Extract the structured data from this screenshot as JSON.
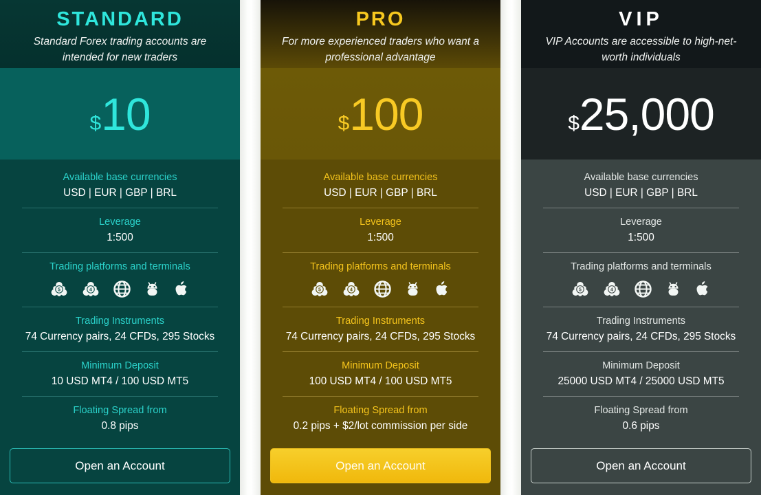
{
  "cards": [
    {
      "plan": "STANDARD",
      "description": "Standard Forex trading accounts are intended for new traders",
      "currency_symbol": "$",
      "price": "10",
      "features": [
        {
          "label": "Available base currencies",
          "value": "USD | EUR | GBP | BRL"
        },
        {
          "label": "Leverage",
          "value": "1:500"
        },
        {
          "label": "Trading platforms and terminals",
          "value": ""
        },
        {
          "label": "Trading Instruments",
          "value": "74 Currency pairs, 24 CFDs, 295 Stocks"
        },
        {
          "label": "Minimum Deposit",
          "value": "10 USD MT4 / 100 USD MT5"
        },
        {
          "label": "Floating Spread from",
          "value": "0.8 pips"
        }
      ],
      "platform_icons": [
        "mt5-icon",
        "mt4-icon",
        "web-globe-icon",
        "android-icon",
        "apple-icon"
      ],
      "cta_label": "Open an Account",
      "accent_color": "#2fe6dc"
    },
    {
      "plan": "PRO",
      "description": "For more experienced traders who want a professional advantage",
      "currency_symbol": "$",
      "price": "100",
      "features": [
        {
          "label": "Available base currencies",
          "value": "USD | EUR | GBP | BRL"
        },
        {
          "label": "Leverage",
          "value": "1:500"
        },
        {
          "label": "Trading platforms and terminals",
          "value": ""
        },
        {
          "label": "Trading Instruments",
          "value": "74 Currency pairs, 24 CFDs, 295 Stocks"
        },
        {
          "label": "Minimum Deposit",
          "value": "100 USD MT4 / 100 USD MT5"
        },
        {
          "label": "Floating Spread from",
          "value": "0.2 pips + $2/lot commission per side"
        }
      ],
      "platform_icons": [
        "mt5-icon",
        "mt4-icon",
        "web-globe-icon",
        "android-icon",
        "apple-icon"
      ],
      "cta_label": "Open an Account",
      "accent_color": "#f7c81f"
    },
    {
      "plan": "VIP",
      "description": "VIP Accounts are accessible to high-net-worth individuals",
      "currency_symbol": "$",
      "price": "25,000",
      "features": [
        {
          "label": "Available base currencies",
          "value": "USD | EUR | GBP | BRL"
        },
        {
          "label": "Leverage",
          "value": "1:500"
        },
        {
          "label": "Trading platforms and terminals",
          "value": ""
        },
        {
          "label": "Trading Instruments",
          "value": "74 Currency pairs, 24 CFDs, 295 Stocks"
        },
        {
          "label": "Minimum Deposit",
          "value": "25000 USD MT4 / 25000 USD MT5"
        },
        {
          "label": "Floating Spread from",
          "value": "0.6 pips"
        }
      ],
      "platform_icons": [
        "mt5-icon",
        "mt4-icon",
        "web-globe-icon",
        "android-icon",
        "apple-icon"
      ],
      "cta_label": "Open an Account",
      "accent_color": "#ffffff"
    }
  ]
}
